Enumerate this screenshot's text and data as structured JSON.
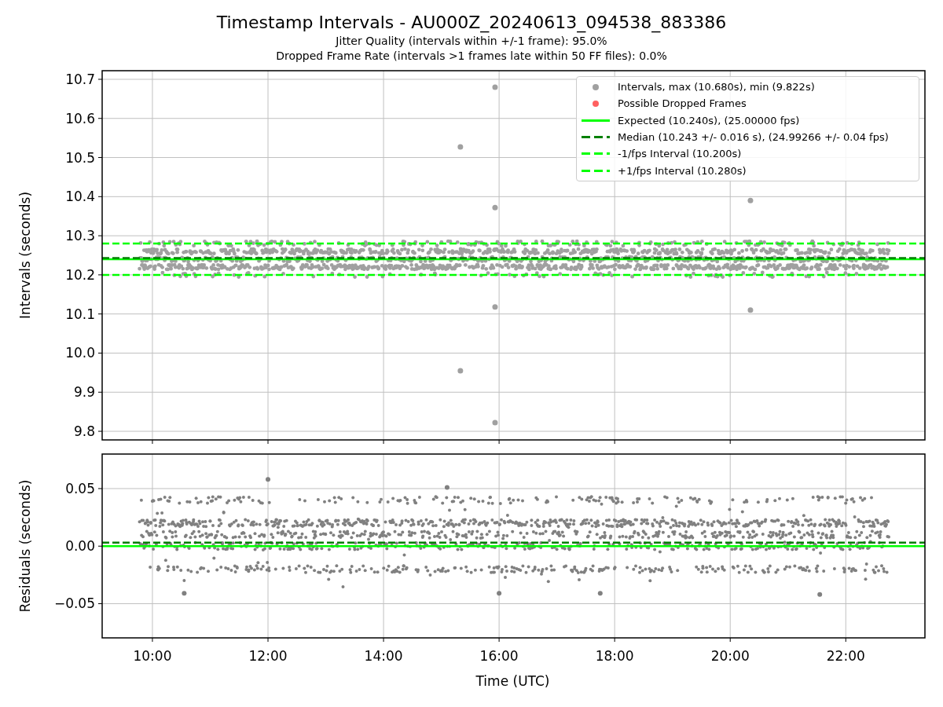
{
  "title": "Timestamp Intervals - AU000Z_20240613_094538_883386",
  "subtitles": [
    "Jitter Quality (intervals within +/-1 frame): 95.0%",
    "Dropped Frame Rate (intervals >1 frames late within 50 FF files): 0.0%"
  ],
  "legend": [
    {
      "label": "Intervals, max (10.680s), min (9.822s)",
      "kind": "dot",
      "color": "#a0a0a0"
    },
    {
      "label": "Possible Dropped Frames",
      "kind": "dot",
      "color": "#ff6060"
    },
    {
      "label": "Expected (10.240s), (25.00000 fps)",
      "kind": "solid",
      "color": "#00ff00"
    },
    {
      "label": "Median (10.243 +/- 0.016 s), (24.99266 +/- 0.04 fps)",
      "kind": "dashed",
      "color": "#008000"
    },
    {
      "label": "-1/fps Interval (10.200s)",
      "kind": "dashed",
      "color": "#00ff00"
    },
    {
      "label": "+1/fps Interval (10.280s)",
      "kind": "dashed",
      "color": "#00ff00"
    }
  ],
  "charts": [
    {
      "lines": [
        {
          "kind": "solid"
        },
        {
          "kind": "dashed"
        },
        {
          "kind": "dashed"
        },
        {
          "kind": "dashed"
        }
      ],
      "chart_data": {
        "type": "scatter",
        "ylabel": "Intervals (seconds)",
        "xlim": [
          9.13,
          23.37
        ],
        "ylim": [
          9.778,
          10.722
        ],
        "grid": true,
        "yticks": [
          {
            "value": 9.8,
            "label": "9.8"
          },
          {
            "value": 9.9,
            "label": "9.9"
          },
          {
            "value": 10.0,
            "label": "10.0"
          },
          {
            "value": 10.1,
            "label": "10.1"
          },
          {
            "value": 10.2,
            "label": "10.2"
          },
          {
            "value": 10.3,
            "label": "10.3"
          },
          {
            "value": 10.4,
            "label": "10.4"
          },
          {
            "value": 10.5,
            "label": "10.5"
          },
          {
            "value": 10.6,
            "label": "10.6"
          },
          {
            "value": 10.7,
            "label": "10.7"
          }
        ],
        "series": [
          {
            "color": "#a0a0a0",
            "x": [
              15.33,
              15.93,
              15.93,
              15.93,
              15.33,
              15.93,
              20.35,
              20.35
            ],
            "values": [
              10.527,
              10.68,
              10.372,
              10.118,
              9.955,
              9.822,
              10.39,
              10.11
            ]
          }
        ],
        "ref_lines": [
          {
            "axis": "y",
            "value": 10.24,
            "color": "#00ff00"
          },
          {
            "axis": "y",
            "value": 10.243,
            "color": "#008000"
          },
          {
            "axis": "y",
            "value": 10.2,
            "color": "#00ff00"
          },
          {
            "axis": "y",
            "value": 10.28,
            "color": "#00ff00"
          }
        ]
      }
    },
    {
      "lines": [
        {
          "kind": "solid"
        },
        {
          "kind": "dashed"
        }
      ],
      "chart_data": {
        "type": "scatter",
        "xlabel": "Time (UTC)",
        "ylabel": "Residuals (seconds)",
        "xlim": [
          9.13,
          23.37
        ],
        "ylim": [
          -0.0797,
          0.08
        ],
        "grid": true,
        "xticks": [
          {
            "value": 10,
            "label": "10:00"
          },
          {
            "value": 12,
            "label": "12:00"
          },
          {
            "value": 14,
            "label": "14:00"
          },
          {
            "value": 16,
            "label": "16:00"
          },
          {
            "value": 18,
            "label": "18:00"
          },
          {
            "value": 20,
            "label": "20:00"
          },
          {
            "value": 22,
            "label": "22:00"
          }
        ],
        "yticks": [
          {
            "value": -0.05,
            "label": "−0.05"
          },
          {
            "value": 0,
            "label": "0.00"
          },
          {
            "value": 0.05,
            "label": "0.05"
          }
        ],
        "series": [
          {
            "color": "#808080",
            "x": [
              12.0,
              15.1,
              10.55,
              16.0,
              17.75,
              21.55
            ],
            "values": [
              0.058,
              0.051,
              -0.041,
              -0.041,
              -0.041,
              -0.042
            ]
          }
        ],
        "ref_lines": [
          {
            "axis": "y",
            "value": 0,
            "color": "#00ff00"
          },
          {
            "axis": "y",
            "value": 0.003,
            "color": "#008000"
          }
        ]
      }
    }
  ]
}
